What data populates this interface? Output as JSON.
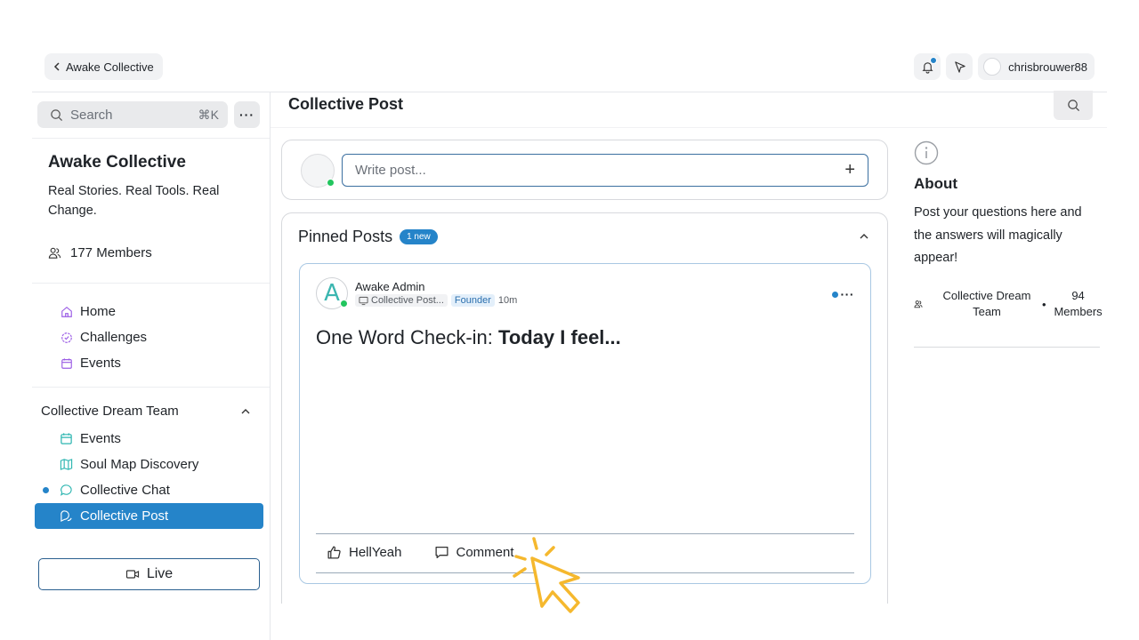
{
  "header": {
    "back_label": "Awake Collective",
    "username": "chrisbrouwer88",
    "notification_dot": true
  },
  "sidebar": {
    "search_placeholder": "Search",
    "search_shortcut": "⌘K",
    "more_label": "···",
    "community_name": "Awake Collective",
    "community_tagline": "Real Stories. Real Tools. Real Change.",
    "members_label": "177 Members",
    "nav": [
      {
        "label": "Home",
        "icon": "home-icon"
      },
      {
        "label": "Challenges",
        "icon": "badge-check-icon"
      },
      {
        "label": "Events",
        "icon": "calendar-icon"
      }
    ],
    "section": {
      "title": "Collective Dream Team",
      "items": [
        {
          "label": "Events",
          "icon": "calendar-icon",
          "unread": false,
          "active": false
        },
        {
          "label": "Soul Map Discovery",
          "icon": "map-icon",
          "unread": false,
          "active": false
        },
        {
          "label": "Collective Chat",
          "icon": "chat-icon",
          "unread": true,
          "active": false
        },
        {
          "label": "Collective Post",
          "icon": "post-icon",
          "unread": false,
          "active": true
        }
      ]
    },
    "live_label": "Live"
  },
  "main": {
    "page_title": "Collective Post",
    "compose_placeholder": "Write post...",
    "compose_plus": "+",
    "pinned_title": "Pinned Posts",
    "pinned_badge": "1 new",
    "post": {
      "avatar_letter": "A",
      "author": "Awake Admin",
      "channel": "Collective Post...",
      "role_badge": "Founder",
      "time": "10m",
      "title_prefix": "One Word Check-in: ",
      "title_bold": "Today I feel...",
      "menu_label": "···",
      "like_label": "HellYeah",
      "comment_label": "Comment"
    }
  },
  "about": {
    "title": "About",
    "text": "Post your questions here and the answers will magically appear!",
    "group_name": "Collective Dream Team",
    "separator": "•",
    "group_count": "94 Members"
  },
  "colors": {
    "accent": "#2584c9",
    "online": "#22c55e",
    "cursor": "#f5b82e"
  }
}
